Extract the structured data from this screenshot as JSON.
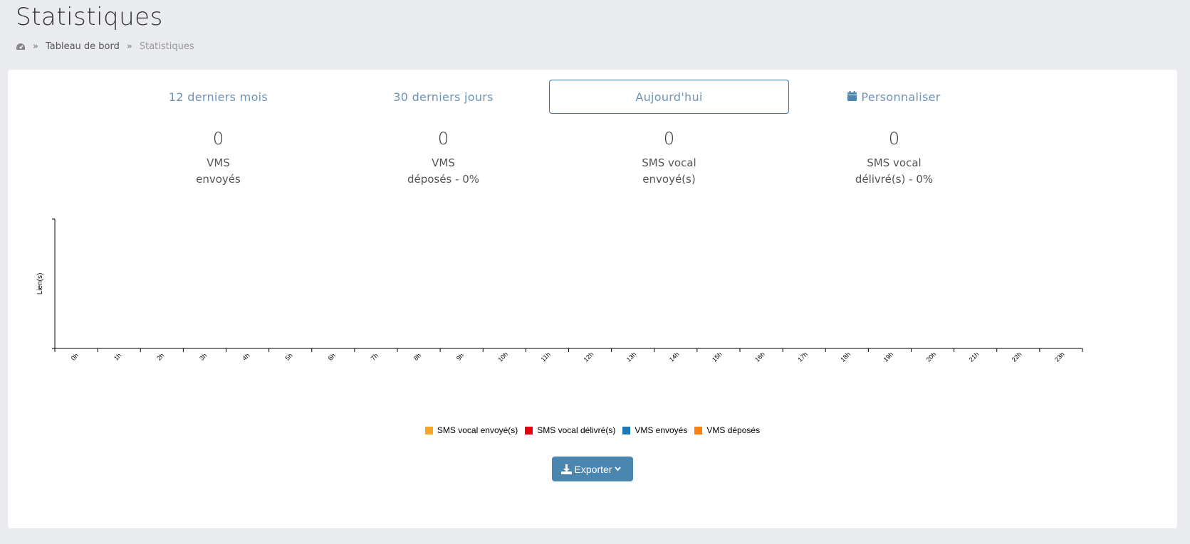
{
  "page": {
    "title": "Statistiques"
  },
  "breadcrumb": {
    "home_icon": "dashboard-icon",
    "items": [
      "Tableau de bord",
      "Statistiques"
    ],
    "separator": "»"
  },
  "tabs": [
    {
      "label": "12 derniers mois",
      "active": false
    },
    {
      "label": "30 derniers jours",
      "active": false
    },
    {
      "label": "Aujourd'hui",
      "active": true
    },
    {
      "label": "Personnaliser",
      "active": false,
      "icon": "calendar-icon"
    }
  ],
  "stats": [
    {
      "value": "0",
      "line1": "VMS",
      "line2": "envoyés"
    },
    {
      "value": "0",
      "line1": "VMS",
      "line2": "déposés - 0%"
    },
    {
      "value": "0",
      "line1": "SMS vocal",
      "line2": "envoyé(s)"
    },
    {
      "value": "0",
      "line1": "SMS vocal",
      "line2": "délivré(s) - 0%"
    }
  ],
  "chart_data": {
    "type": "bar",
    "ylabel": "Lien(s)",
    "categories": [
      "0h",
      "1h",
      "2h",
      "3h",
      "4h",
      "5h",
      "6h",
      "7h",
      "8h",
      "9h",
      "10h",
      "11h",
      "12h",
      "13h",
      "14h",
      "15h",
      "16h",
      "17h",
      "18h",
      "19h",
      "20h",
      "21h",
      "22h",
      "23h"
    ],
    "series": [
      {
        "name": "SMS vocal envoyé(s)",
        "color": "#f5a623",
        "values": [
          0,
          0,
          0,
          0,
          0,
          0,
          0,
          0,
          0,
          0,
          0,
          0,
          0,
          0,
          0,
          0,
          0,
          0,
          0,
          0,
          0,
          0,
          0,
          0
        ]
      },
      {
        "name": "SMS vocal délivré(s)",
        "color": "#e8000b",
        "values": [
          0,
          0,
          0,
          0,
          0,
          0,
          0,
          0,
          0,
          0,
          0,
          0,
          0,
          0,
          0,
          0,
          0,
          0,
          0,
          0,
          0,
          0,
          0,
          0
        ]
      },
      {
        "name": "VMS envoyés",
        "color": "#1f77b4",
        "values": [
          0,
          0,
          0,
          0,
          0,
          0,
          0,
          0,
          0,
          0,
          0,
          0,
          0,
          0,
          0,
          0,
          0,
          0,
          0,
          0,
          0,
          0,
          0,
          0
        ]
      },
      {
        "name": "VMS déposés",
        "color": "#ff7f0e",
        "values": [
          0,
          0,
          0,
          0,
          0,
          0,
          0,
          0,
          0,
          0,
          0,
          0,
          0,
          0,
          0,
          0,
          0,
          0,
          0,
          0,
          0,
          0,
          0,
          0
        ]
      }
    ],
    "legend_position": "bottom-center"
  },
  "export": {
    "label": "Exporter",
    "icon": "download-icon",
    "chevron": "chevron-down-icon"
  }
}
